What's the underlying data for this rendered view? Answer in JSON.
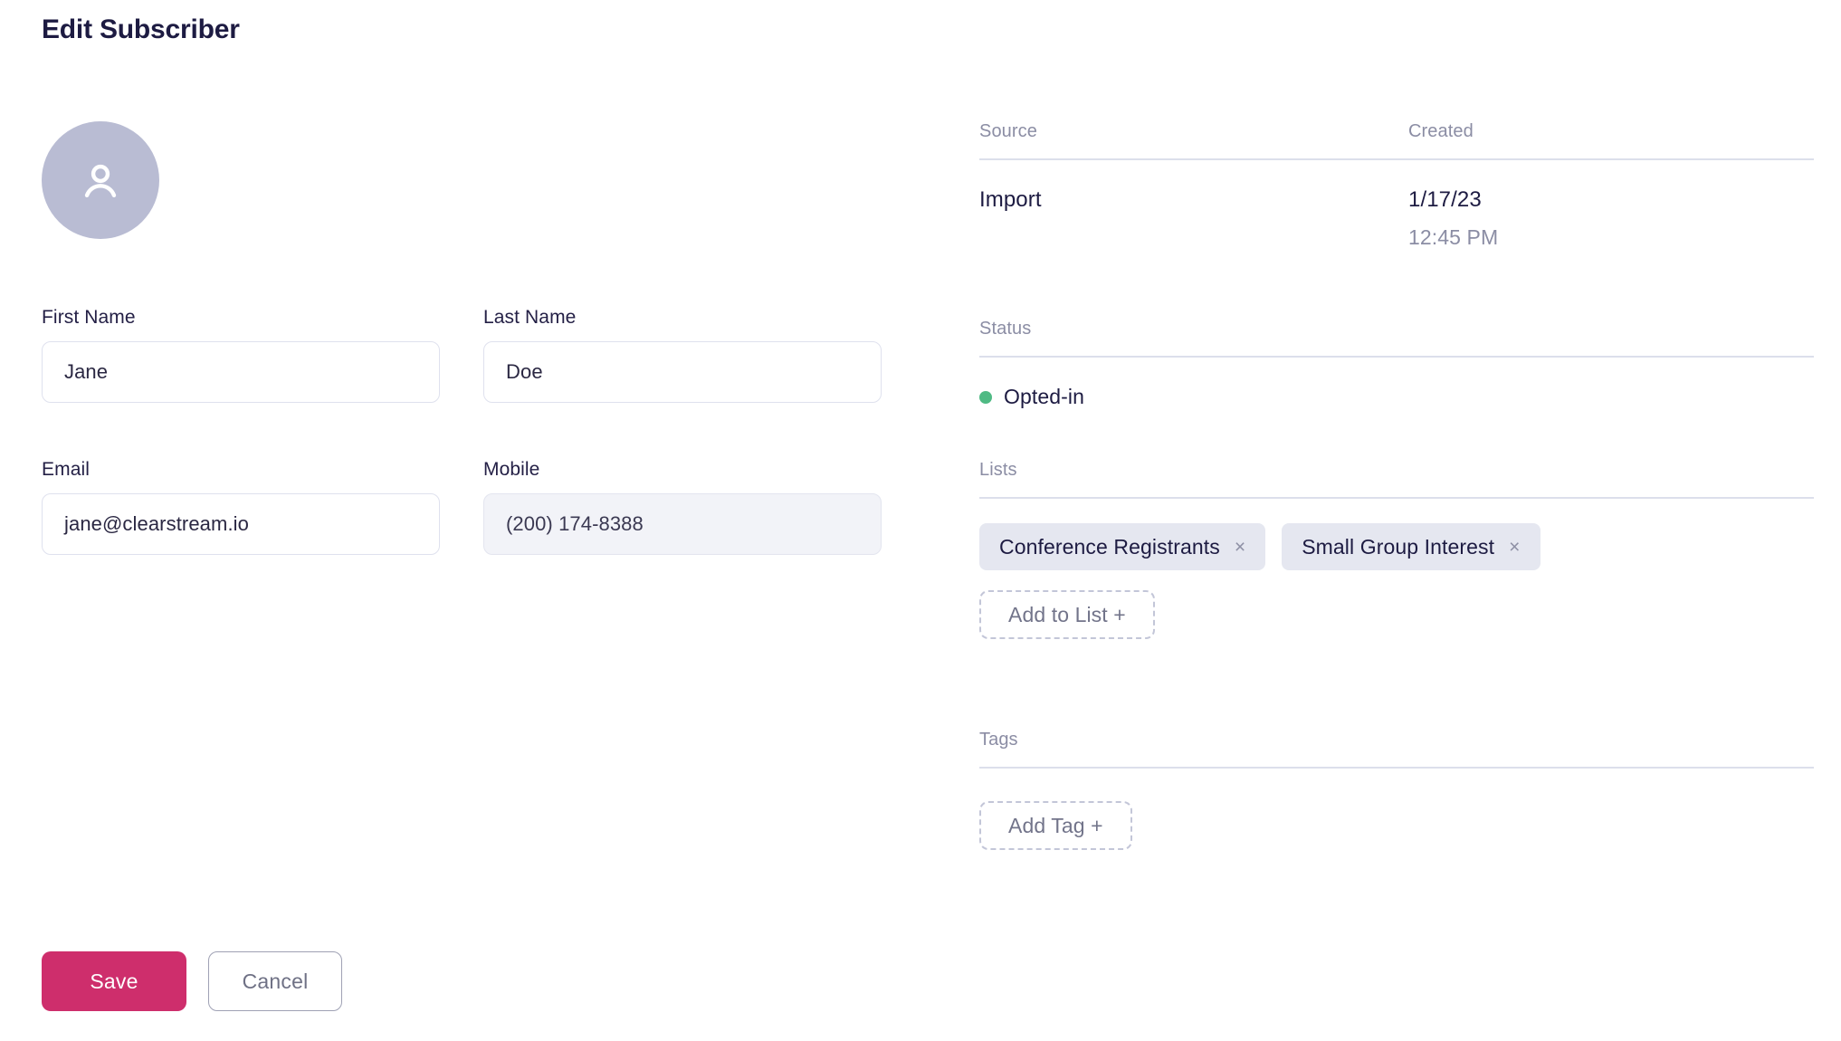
{
  "page": {
    "title": "Edit Subscriber"
  },
  "avatar": {
    "icon": "user-avatar-icon"
  },
  "form": {
    "fields": [
      {
        "label": "First Name",
        "value": "Jane",
        "disabled": false
      },
      {
        "label": "Last Name",
        "value": "Doe",
        "disabled": false
      },
      {
        "label": "Email",
        "value": "jane@clearstream.io",
        "disabled": false
      },
      {
        "label": "Mobile",
        "value": "(200) 174-8388",
        "disabled": true
      }
    ]
  },
  "actions": {
    "save_label": "Save",
    "cancel_label": "Cancel"
  },
  "details": {
    "meta": {
      "source_header": "Source",
      "created_header": "Created",
      "source_value": "Import",
      "created_date": "1/17/23",
      "created_time": "12:45 PM"
    },
    "status": {
      "label": "Status",
      "value": "Opted-in",
      "dot_color": "#4fba84"
    },
    "lists": {
      "label": "Lists",
      "chips": [
        {
          "name": "Conference Registrants",
          "remove_icon": "×"
        },
        {
          "name": "Small Group Interest",
          "remove_icon": "×"
        }
      ],
      "add_label": "Add to List +"
    },
    "tags": {
      "label": "Tags",
      "chips": [],
      "add_label": "Add Tag +"
    }
  },
  "colors": {
    "accent_save": "#ce2e6c",
    "title": "#1d1b42",
    "muted": "#8b8da4",
    "chip_bg": "#e5e7f0",
    "avatar_bg": "#b9bcd3",
    "divider": "#dcdfeb",
    "status_green": "#4fba84"
  }
}
